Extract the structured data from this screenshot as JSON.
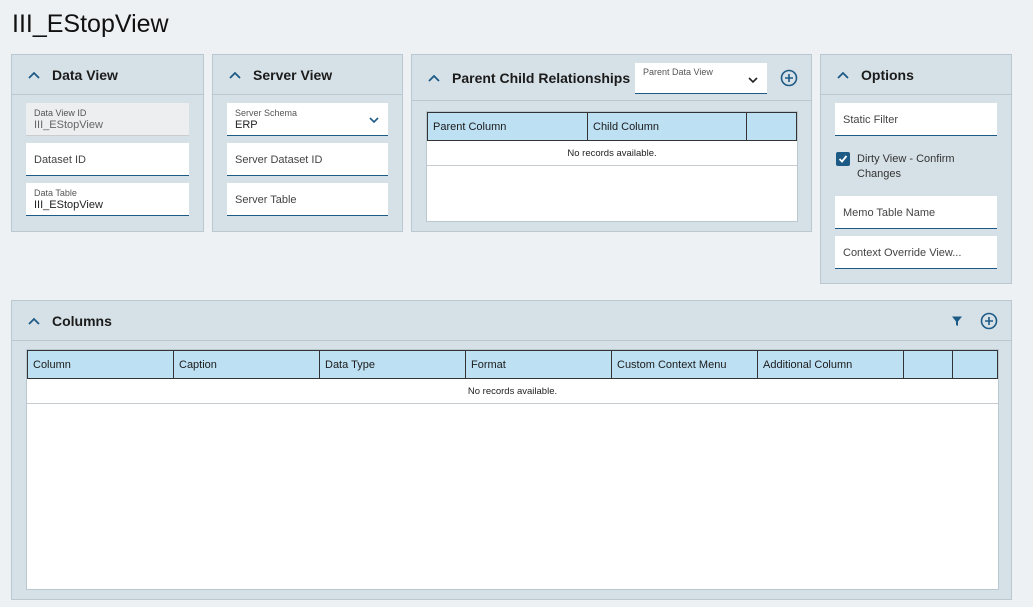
{
  "page": {
    "title": "III_EStopView"
  },
  "data_view": {
    "title": "Data View",
    "data_view_id_label": "Data View ID",
    "data_view_id_value": "III_EStopView",
    "dataset_id_placeholder": "Dataset ID",
    "data_table_label": "Data Table",
    "data_table_value": "III_EStopView"
  },
  "server_view": {
    "title": "Server View",
    "server_schema_label": "Server Schema",
    "server_schema_value": "ERP",
    "server_dataset_id_placeholder": "Server Dataset ID",
    "server_table_placeholder": "Server Table"
  },
  "parent_child": {
    "title": "Parent Child Relationships",
    "parent_data_view_label": "Parent Data View",
    "columns": [
      "Parent Column",
      "Child Column",
      ""
    ],
    "empty_text": "No records available."
  },
  "options": {
    "title": "Options",
    "static_filter_placeholder": "Static Filter",
    "dirty_view_label": "Dirty View - Confirm Changes",
    "dirty_view_checked": true,
    "memo_table_placeholder": "Memo Table Name",
    "context_override_placeholder": "Context Override View..."
  },
  "columns_panel": {
    "title": "Columns",
    "columns": [
      "Column",
      "Caption",
      "Data Type",
      "Format",
      "Custom Context Menu",
      "Additional Column",
      "",
      ""
    ],
    "empty_text": "No records available."
  },
  "colors": {
    "accent": "#1e5a86",
    "panel_bg": "#d6e1e7",
    "grid_header_bg": "#bde0f3",
    "page_bg": "#eef1f4"
  },
  "icons": {
    "collapse": "chevron-up-icon",
    "dropdown": "chevron-down-icon",
    "add": "plus-circle-icon",
    "filter": "filter-icon",
    "check": "checkmark-icon"
  }
}
